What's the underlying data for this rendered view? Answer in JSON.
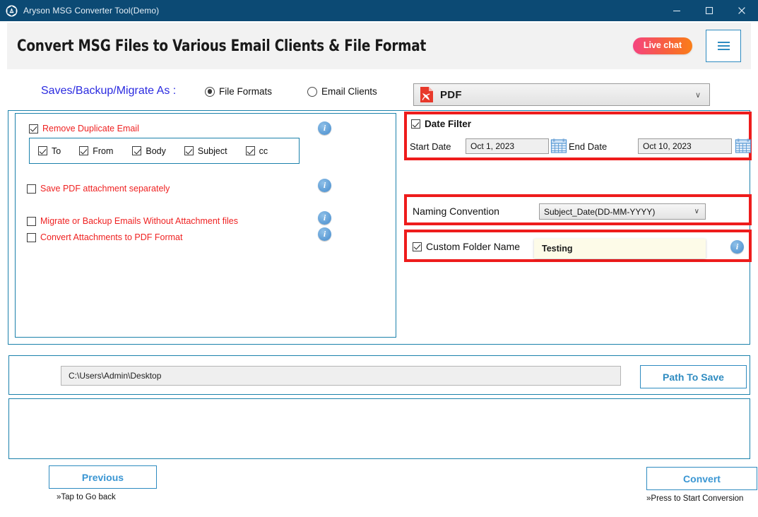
{
  "window": {
    "title": "Aryson MSG Converter Tool(Demo)",
    "logo_icon": "aryson-logo-icon",
    "controls": {
      "minimize": "minimize-icon",
      "maximize": "maximize-icon",
      "close": "close-icon"
    }
  },
  "header": {
    "title": "Convert MSG Files to Various Email Clients & File Format",
    "live_chat_label": "Live chat",
    "menu_icon": "hamburger-menu-icon",
    "accent_gradient_from": "#f5447f",
    "accent_gradient_to": "#fa7e18"
  },
  "options_row": {
    "saves_label": "Saves/Backup/Migrate As :",
    "saves_label_color": "#2b2be0",
    "radios": [
      {
        "label": "File Formats",
        "selected": true
      },
      {
        "label": "Email Clients",
        "selected": false
      }
    ],
    "format_select": {
      "value": "PDF",
      "icon": "pdf-file-icon",
      "caret": "∨"
    }
  },
  "left_panel": {
    "remove_duplicate": {
      "label": "Remove Duplicate Email",
      "checked": true,
      "color": "#ef2222"
    },
    "duplicate_fields": [
      {
        "label": "To",
        "checked": true
      },
      {
        "label": "From",
        "checked": true
      },
      {
        "label": "Body",
        "checked": true
      },
      {
        "label": "Subject",
        "checked": true
      },
      {
        "label": "cc",
        "checked": true
      }
    ],
    "options": [
      {
        "label": "Save PDF attachment separately",
        "checked": false
      },
      {
        "label": "Migrate or Backup Emails Without Attachment files",
        "checked": false
      },
      {
        "label": "Convert Attachments to PDF Format",
        "checked": false
      }
    ],
    "info_icon": "info-icon",
    "info_glyph": "i"
  },
  "date_filter": {
    "title": "Date Filter",
    "checked": true,
    "start_label": "Start Date",
    "start_value": "Oct 1, 2023",
    "end_label": "End Date",
    "end_value": "Oct 10, 2023",
    "calendar_icon": "calendar-icon",
    "highlight_color": "#ee1c1c"
  },
  "naming_convention": {
    "label": "Naming Convention",
    "value": "Subject_Date(DD-MM-YYYY)",
    "caret": "∨",
    "highlight_color": "#ee1c1c"
  },
  "custom_folder": {
    "label": "Custom Folder Name",
    "checked": true,
    "value": "Testing",
    "info_glyph": "i",
    "highlight_color": "#ee1c1c"
  },
  "path_panel": {
    "path_value": "C:\\Users\\Admin\\Desktop",
    "button_label": "Path To Save"
  },
  "footer": {
    "previous_label": "Previous",
    "previous_hint": "»Tap to Go back",
    "convert_label": "Convert",
    "convert_hint": "»Press to Start Conversion"
  }
}
